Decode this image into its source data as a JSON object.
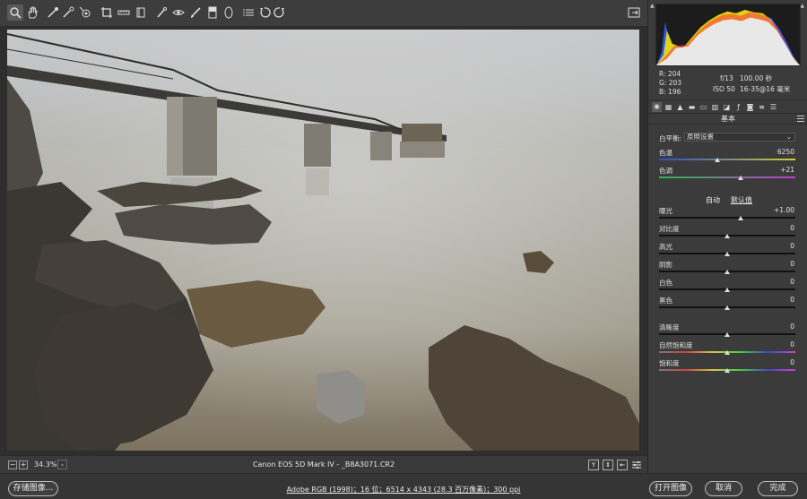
{
  "toolbar": {
    "tools": [
      {
        "name": "zoom-tool",
        "icon": "zoom-icon"
      },
      {
        "name": "hand-tool",
        "icon": "hand-icon"
      },
      {
        "name": "white-balance-tool",
        "icon": "eyedropper-icon"
      },
      {
        "name": "color-sampler-tool",
        "icon": "color-sampler-icon"
      },
      {
        "name": "targeted-adjustment-tool",
        "icon": "target-icon"
      },
      {
        "name": "crop-tool",
        "icon": "crop-icon"
      },
      {
        "name": "straighten-tool",
        "icon": "straighten-icon"
      },
      {
        "name": "transform-tool",
        "icon": "transform-icon"
      },
      {
        "name": "spot-removal-tool",
        "icon": "spot-removal-icon"
      },
      {
        "name": "red-eye-tool",
        "icon": "red-eye-icon"
      },
      {
        "name": "adjustment-brush-tool",
        "icon": "brush-icon"
      },
      {
        "name": "graduated-filter-tool",
        "icon": "graduated-filter-icon"
      },
      {
        "name": "radial-filter-tool",
        "icon": "radial-filter-icon"
      },
      {
        "name": "preferences-tool",
        "icon": "list-icon"
      },
      {
        "name": "rotate-ccw-tool",
        "icon": "rotate-left-icon"
      },
      {
        "name": "rotate-cw-tool",
        "icon": "rotate-right-icon"
      }
    ]
  },
  "statusbar": {
    "zoom": "34.3%",
    "filename": "Canon EOS 5D Mark IV  -  _B8A3071.CR2",
    "view_buttons": [
      "Y"
    ]
  },
  "bottom": {
    "save_label": "存储图像...",
    "workflow_link": "Adobe RGB (1998)；16 位；6514 x 4343 (28.3 百万像素)；300 ppi",
    "open_label": "打开图像",
    "cancel_label": "取消",
    "done_label": "完成"
  },
  "panel": {
    "rgb": {
      "r": "R:  204",
      "g": "G:  203",
      "b": "B:  196"
    },
    "camera": {
      "aperture": "f/13",
      "shutter": "100.00 秒",
      "iso": "ISO 50",
      "lens": "16-35@16 毫米"
    },
    "section_title": "基本",
    "white_balance_label": "白平衡:",
    "white_balance_value": "原照设置",
    "auto_label": "自动",
    "default_label": "默认值",
    "sliders": [
      {
        "key": "temp",
        "label": "色温",
        "value": "6250",
        "level": 0.43
      },
      {
        "key": "tint",
        "label": "色调",
        "value": "+21",
        "level": 0.6
      },
      {
        "key": "exposure",
        "label": "曝光",
        "value": "+1.00",
        "level": 0.6
      },
      {
        "key": "contrast",
        "label": "对比度",
        "value": "0",
        "level": 0.5
      },
      {
        "key": "highlights",
        "label": "高光",
        "value": "0",
        "level": 0.5
      },
      {
        "key": "shadows",
        "label": "阴影",
        "value": "0",
        "level": 0.5
      },
      {
        "key": "whites",
        "label": "白色",
        "value": "0",
        "level": 0.5
      },
      {
        "key": "blacks",
        "label": "黑色",
        "value": "0",
        "level": 0.5
      },
      {
        "key": "clarity",
        "label": "清晰度",
        "value": "0",
        "level": 0.5
      },
      {
        "key": "vibrance",
        "label": "自然饱和度",
        "value": "0",
        "level": 0.5
      },
      {
        "key": "saturation",
        "label": "饱和度",
        "value": "0",
        "level": 0.5
      }
    ]
  }
}
